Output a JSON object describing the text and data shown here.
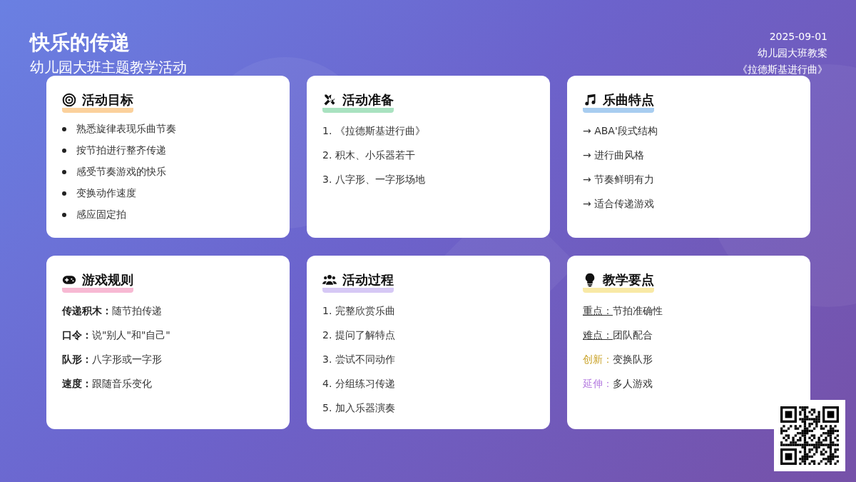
{
  "header": {
    "title": "快乐的传递",
    "subtitle": "幼儿园大班主题教学活动",
    "meta": [
      "2025-09-01",
      "幼儿园大班教案",
      "《拉德斯基进行曲》"
    ]
  },
  "cards": [
    {
      "title": "活动目标",
      "color": "#fbd19c",
      "kind": "bullet",
      "items": [
        "熟悉旋律表现乐曲节奏",
        "按节拍进行整齐传递",
        "感受节奏游戏的快乐",
        "变换动作速度",
        "感应固定拍"
      ]
    },
    {
      "title": "活动准备",
      "color": "#a9e2c0",
      "kind": "plain",
      "items": [
        "1. 《拉德斯基进行曲》",
        "2. 积木、小乐器若干",
        "3. 八字形、一字形场地"
      ]
    },
    {
      "title": "乐曲特点",
      "color": "#a8cdf0",
      "kind": "plain",
      "items": [
        "→ ABA'段式结构",
        "→ 进行曲风格",
        "→ 节奏鲜明有力",
        "→ 适合传递游戏"
      ]
    },
    {
      "title": "游戏规则",
      "color": "#f7b9d3",
      "kind": "labeled",
      "items": [
        {
          "label": "传递积木：",
          "text": "随节拍传递",
          "kind": "bold"
        },
        {
          "label": "口令：",
          "text": "说\"别人\"和\"自己\"",
          "kind": "bold"
        },
        {
          "label": "队形：",
          "text": "八字形或一字形",
          "kind": "bold"
        },
        {
          "label": "速度：",
          "text": "跟随音乐变化",
          "kind": "bold"
        }
      ]
    },
    {
      "title": "活动过程",
      "color": "#d6c8f5",
      "kind": "plain",
      "items": [
        "1. 完整欣赏乐曲",
        "2. 提问了解特点",
        "3. 尝试不同动作",
        "4. 分组练习传递",
        "5. 加入乐器演奏"
      ]
    },
    {
      "title": "教学要点",
      "color": "#f8e9a6",
      "kind": "labeled",
      "items": [
        {
          "label": "重点：",
          "text": "节拍准确性",
          "kind": "underline"
        },
        {
          "label": "难点：",
          "text": "团队配合",
          "kind": "underline"
        },
        {
          "label": "创新：",
          "text": "变换队形",
          "kind": "accent",
          "color": "#c9a227"
        },
        {
          "label": "延伸：",
          "text": "多人游戏",
          "kind": "accent",
          "color": "#b57be0"
        }
      ]
    }
  ]
}
